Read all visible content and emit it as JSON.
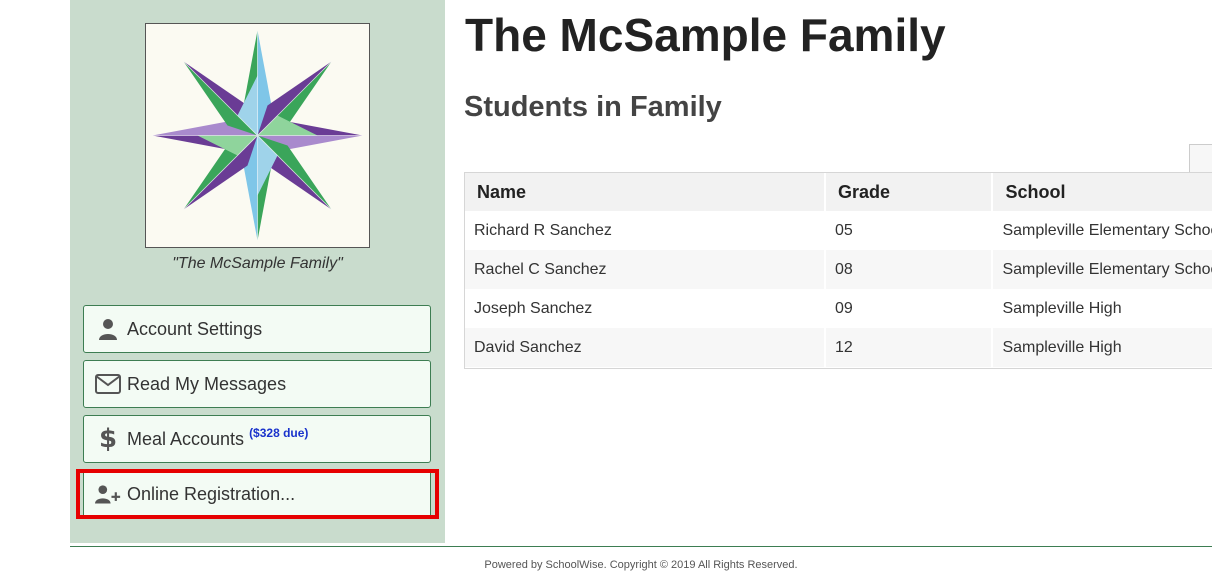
{
  "family": {
    "name": "The McSample Family",
    "logo_caption": "\"The McSample Family\""
  },
  "sidebar": {
    "logo_icon": "quilt-star-logo",
    "items": [
      {
        "label": "Account Settings",
        "icon": "user-icon"
      },
      {
        "label": "Read My Messages",
        "icon": "envelope-icon"
      },
      {
        "label": "Meal Accounts",
        "icon": "dollar-icon",
        "badge": "($328 due)"
      },
      {
        "label": "Online Registration...",
        "icon": "user-plus-icon",
        "highlighted": true
      }
    ]
  },
  "students": {
    "heading": "Students in Family",
    "columns": [
      "Name",
      "Grade",
      "School"
    ],
    "rows": [
      {
        "name": "Richard R Sanchez",
        "grade": "05",
        "school": "Sampleville Elementary School"
      },
      {
        "name": "Rachel C Sanchez",
        "grade": "08",
        "school": "Sampleville Elementary School"
      },
      {
        "name": "Joseph Sanchez",
        "grade": "09",
        "school": "Sampleville High"
      },
      {
        "name": "David Sanchez",
        "grade": "12",
        "school": "Sampleville High"
      }
    ]
  },
  "footer": {
    "text": "Powered by SchoolWise. Copyright © 2019 All Rights Reserved."
  },
  "colors": {
    "sidebar_bg": "#c9dccd",
    "button_border": "#3d7d52",
    "highlight": "#e60000",
    "badge": "#1a33cc"
  }
}
